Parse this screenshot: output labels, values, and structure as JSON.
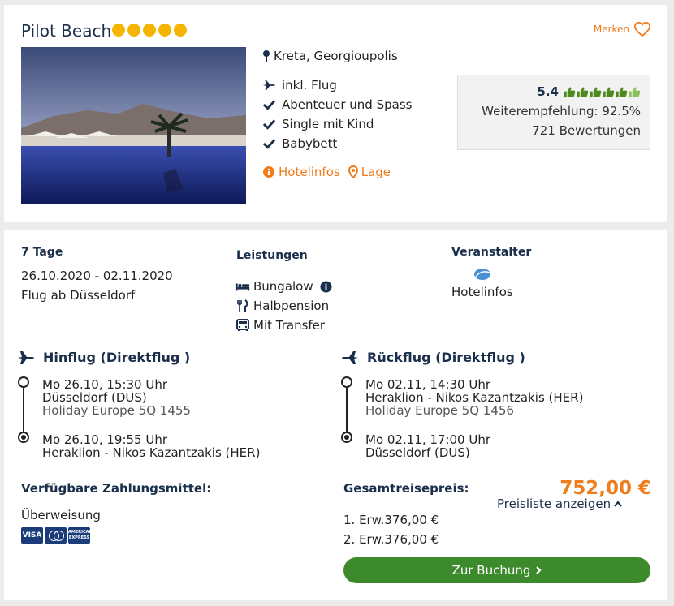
{
  "hotel": {
    "name": "Pilot Beach",
    "stars": 5,
    "merken_label": "Merken",
    "location": "Kreta, Georgioupolis",
    "features": [
      "inkl. Flug",
      "Abenteuer und Spass",
      "Single mit Kind",
      "Babybett"
    ],
    "links": {
      "hotelinfos": "Hotelinfos",
      "lage": "Lage"
    },
    "rating": {
      "score": "5.4",
      "thumbs_filled": 6,
      "thumbs_total": 6,
      "recommendation": "Weiterempfehlung: 92.5%",
      "reviews": "721 Bewertungen"
    }
  },
  "trip": {
    "duration": "7 Tage",
    "dates": "26.10.2020 - 02.11.2020",
    "departure": "Flug ab Düsseldorf"
  },
  "services": {
    "label": "Leistungen",
    "items": [
      "Bungalow",
      "Halbpension",
      "Mit Transfer"
    ]
  },
  "operator": {
    "label": "Veranstalter",
    "link": "Hotelinfos"
  },
  "outbound": {
    "title": "Hinflug (Direktflug )",
    "dep_time": "Mo 26.10, 15:30 Uhr",
    "dep_airport": "Düsseldorf (DUS)",
    "flight_no": "Holiday Europe 5Q 1455",
    "arr_time": "Mo 26.10, 19:55 Uhr",
    "arr_airport": "Heraklion - Nikos Kazantzakis (HER)"
  },
  "return": {
    "title": "Rückflug (Direktflug )",
    "dep_time": "Mo 02.11, 14:30 Uhr",
    "dep_airport": "Heraklion - Nikos Kazantzakis (HER)",
    "flight_no": "Holiday Europe 5Q 1456",
    "arr_time": "Mo 02.11, 17:00 Uhr",
    "arr_airport": "Düsseldorf (DUS)"
  },
  "payment": {
    "label": "Verfügbare Zahlungsmittel:",
    "method": "Überweisung",
    "cards": [
      "VISA",
      "Mastercard",
      "American Express"
    ]
  },
  "price": {
    "label": "Gesamtreisepreis:",
    "total": "752,00 €",
    "pricelist_label": "Preisliste anzeigen",
    "lines": [
      "1. Erw.376,00 €",
      "2. Erw.376,00 €"
    ],
    "book_label": "Zur Buchung"
  },
  "colors": {
    "accent": "#ef7d1e",
    "navy": "#1a2f4c",
    "green": "#3d8a2c",
    "star": "#f5b400"
  }
}
